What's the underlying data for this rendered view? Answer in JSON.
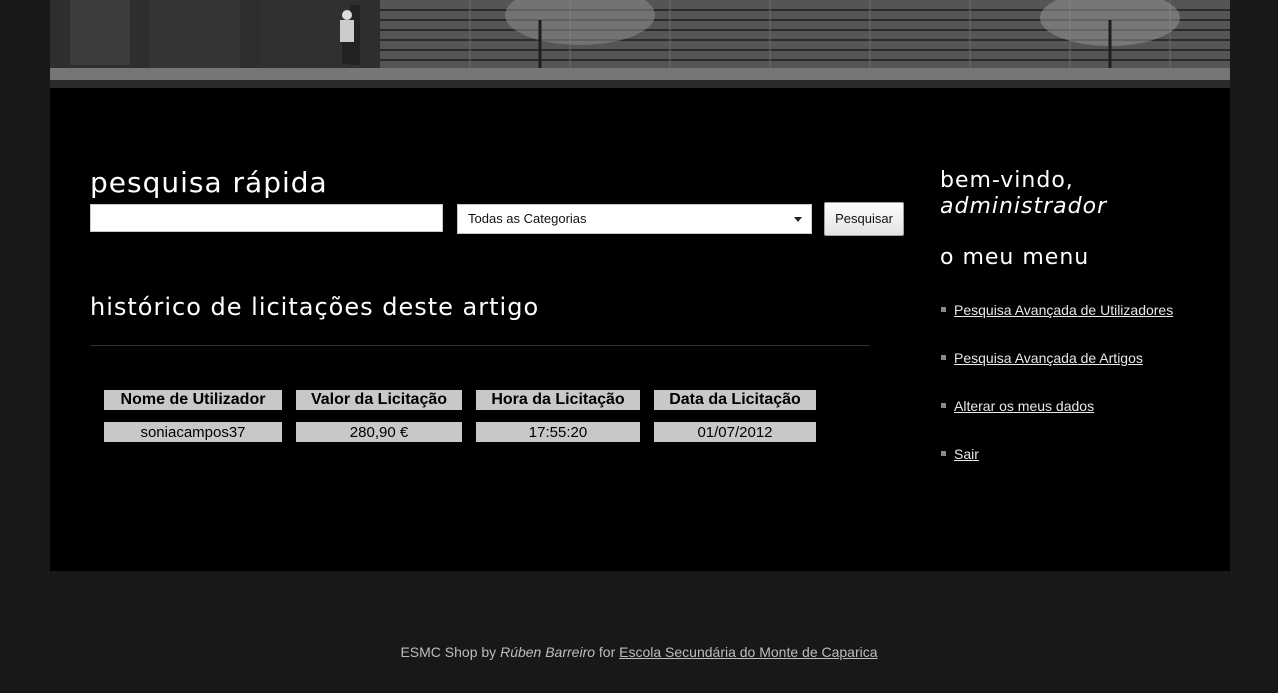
{
  "search": {
    "title": "pesquisa rápida",
    "input_value": "",
    "category_selected": "Todas as Categorias",
    "button_label": "Pesquisar"
  },
  "history": {
    "title": "histórico de licitações deste artigo",
    "columns": [
      "Nome de Utilizador",
      "Valor da Licitação",
      "Hora da Licitação",
      "Data da Licitação"
    ],
    "rows": [
      [
        "soniacampos37",
        "280,90 €",
        "17:55:20",
        "01/07/2012"
      ]
    ]
  },
  "sidebar": {
    "welcome": "bem-vindo,",
    "username": "administrador",
    "menu_title": "o meu menu",
    "menu_items": [
      "Pesquisa Avançada de Utilizadores",
      "Pesquisa Avançada de Artigos",
      "Alterar os meus dados",
      "Sair"
    ]
  },
  "footer": {
    "prefix": "ESMC Shop by",
    "author": "Rúben Barreiro",
    "middle": "for",
    "school_link": "Escola Secundária do Monte de Caparica"
  }
}
